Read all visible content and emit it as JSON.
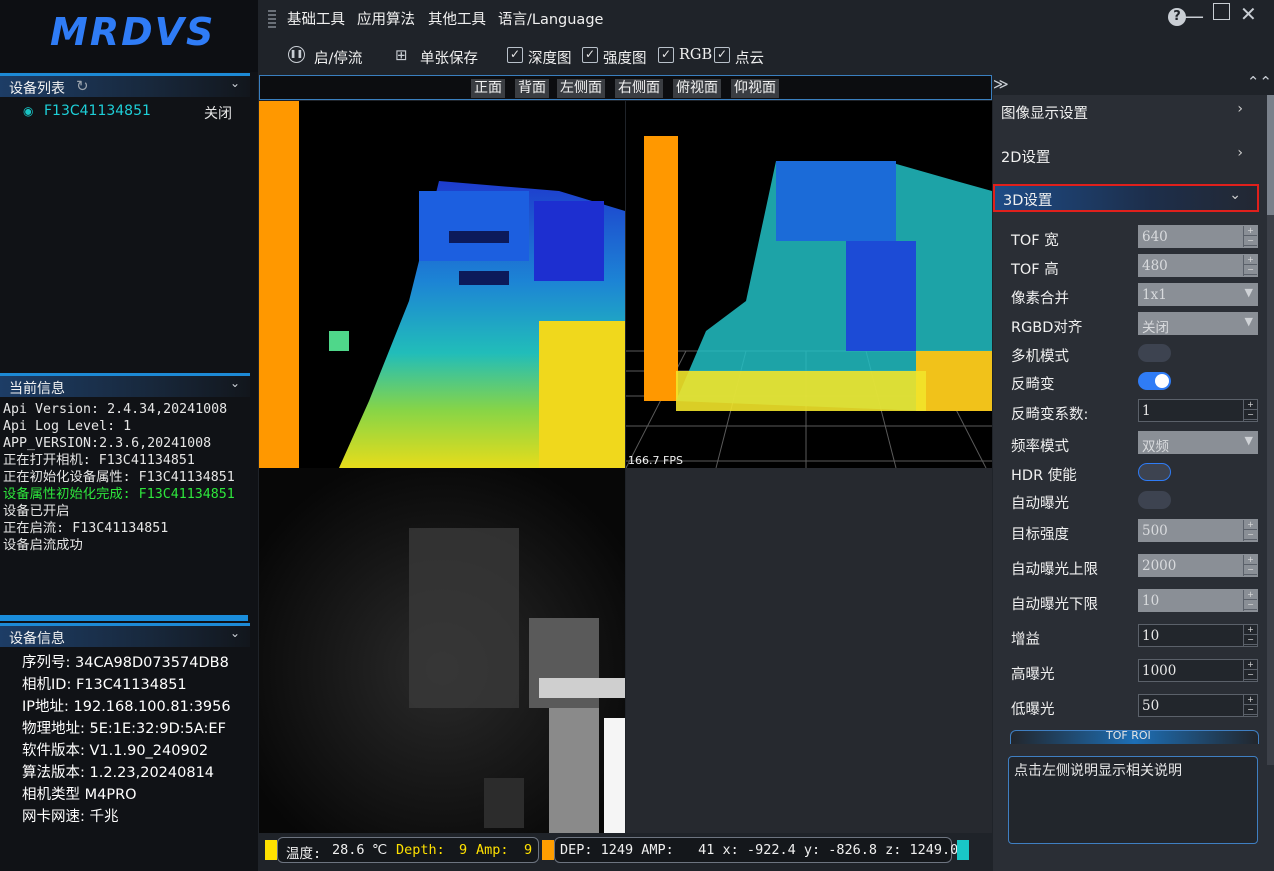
{
  "app": {
    "logo": "MRDVS"
  },
  "menu": {
    "items": [
      "基础工具",
      "应用算法",
      "其他工具",
      "语言/Language"
    ]
  },
  "toolbar": {
    "start_stop": "启/停流",
    "single_save": "单张保存",
    "checks": [
      {
        "label": "深度图",
        "checked": true
      },
      {
        "label": "强度图",
        "checked": true
      },
      {
        "label": "RGB",
        "checked": true
      },
      {
        "label": "点云",
        "checked": true
      }
    ]
  },
  "view_buttons": [
    "正面",
    "背面",
    "左侧面",
    "右侧面",
    "俯视面",
    "仰视面"
  ],
  "device_list": {
    "title": "设备列表",
    "devices": [
      {
        "name": "F13C41134851",
        "status": "关闭"
      }
    ]
  },
  "current_info": {
    "title": "当前信息",
    "log": [
      {
        "text": "Api Version: 2.4.34,20241008",
        "ok": false
      },
      {
        "text": "Api Log Level: 1",
        "ok": false
      },
      {
        "text": "APP_VERSION:2.3.6,20241008",
        "ok": false
      },
      {
        "text": "正在打开相机: F13C41134851",
        "ok": false
      },
      {
        "text": "正在初始化设备属性: F13C41134851",
        "ok": false
      },
      {
        "text": "设备属性初始化完成: F13C41134851",
        "ok": true
      },
      {
        "text": "设备已开启",
        "ok": false
      },
      {
        "text": "正在启流: F13C41134851",
        "ok": false
      },
      {
        "text": "设备启流成功",
        "ok": false
      }
    ]
  },
  "device_info": {
    "title": "设备信息",
    "rows": [
      {
        "k": "序列号:",
        "v": "34CA98D073574DB8"
      },
      {
        "k": "相机ID:",
        "v": "F13C41134851"
      },
      {
        "k": "IP地址:",
        "v": "192.168.100.81:3956"
      },
      {
        "k": "物理地址:",
        "v": "5E:1E:32:9D:5A:EF"
      },
      {
        "k": "软件版本:",
        "v": "V1.1.90_240902"
      },
      {
        "k": "算法版本:",
        "v": "1.2.23,20240814"
      },
      {
        "k": "相机类型",
        "v": "M4PRO"
      },
      {
        "k": "网卡网速:",
        "v": "千兆"
      }
    ]
  },
  "viewer": {
    "fps": "166.7 FPS"
  },
  "status": {
    "temp_label": "温度:",
    "temp_value": "28.6",
    "temp_unit": "℃",
    "depth_label": "Depth:",
    "depth_value": "9",
    "amp_label": "Amp:",
    "amp_value": "9",
    "cursor": "DEP: 1249 AMP:   41 x: -922.4 y: -826.8 z: 1249.0",
    "colors": {
      "yellow": "#ffe100",
      "orange": "#ff9e00",
      "cyan": "#19c7c7"
    }
  },
  "right_panel": {
    "sections": [
      {
        "label": "图像显示设置",
        "expanded": false
      },
      {
        "label": "2D设置",
        "expanded": false
      },
      {
        "label": "3D设置",
        "expanded": true
      }
    ],
    "params": [
      {
        "label": "TOF 宽",
        "type": "spin",
        "value": "640",
        "disabled": true
      },
      {
        "label": "TOF 高",
        "type": "spin",
        "value": "480",
        "disabled": true
      },
      {
        "label": "像素合并",
        "type": "combo",
        "value": "1x1",
        "disabled": true
      },
      {
        "label": "RGBD对齐",
        "type": "combo",
        "value": "关闭",
        "disabled": true
      },
      {
        "label": "多机模式",
        "type": "toggle",
        "on": false
      },
      {
        "label": "反畸变",
        "type": "toggle",
        "on": true
      },
      {
        "label": "反畸变系数:",
        "type": "spin",
        "value": "1",
        "disabled": false
      },
      {
        "label": "频率模式",
        "type": "combo",
        "value": "双频",
        "disabled": true
      },
      {
        "label": "HDR 使能",
        "type": "toggle",
        "on": false,
        "focus": true
      },
      {
        "label": "自动曝光",
        "type": "toggle",
        "on": false
      },
      {
        "label": "目标强度",
        "type": "spin",
        "value": "500",
        "disabled": true
      },
      {
        "label": "自动曝光上限",
        "type": "spin",
        "value": "2000",
        "disabled": true
      },
      {
        "label": "自动曝光下限",
        "type": "spin",
        "value": "10",
        "disabled": true
      },
      {
        "label": "增益",
        "type": "spin",
        "value": "10",
        "disabled": false
      },
      {
        "label": "高曝光",
        "type": "spin",
        "value": "1000",
        "disabled": false
      },
      {
        "label": "低曝光",
        "type": "spin",
        "value": "50",
        "disabled": false
      }
    ],
    "roi_button": "TOF ROI",
    "help_text": "点击左侧说明显示相关说明"
  }
}
